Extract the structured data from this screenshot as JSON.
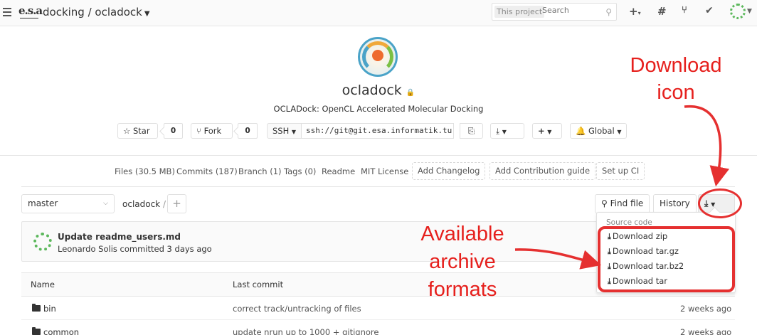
{
  "nav": {
    "logo_text": "e.s.a",
    "breadcrumb": "docking / ocladock",
    "search_scope": "This project",
    "search_placeholder": "Search",
    "icons": [
      "plus-icon",
      "hash-icon",
      "merge-request-icon",
      "check-circle-icon"
    ]
  },
  "project": {
    "name": "ocladock",
    "description": "OCLADock: OpenCL Accelerated Molecular Docking",
    "star_label": "Star",
    "star_count": "0",
    "fork_label": "Fork",
    "fork_count": "0",
    "protocol": "SSH",
    "clone_url": "ssh://git@git.esa.informatik.tu",
    "notify_label": "Global"
  },
  "project_links": {
    "files": "Files (30.5 MB)",
    "commits": "Commits (187)",
    "branch": "Branch (1)",
    "tags": "Tags (0)",
    "readme": "Readme",
    "license": "MIT License",
    "add_changelog": "Add Changelog",
    "add_contribution": "Add Contribution guide",
    "setup_ci": "Set up CI"
  },
  "repo": {
    "branch": "master",
    "path": "ocladock",
    "path_sep": "/",
    "find_file": "Find file",
    "history": "History"
  },
  "last_commit": {
    "title": "Update readme_users.md",
    "meta": "Leonardo Solis committed 3 days ago"
  },
  "table": {
    "headers": {
      "name": "Name",
      "last_commit": "Last commit"
    },
    "rows": [
      {
        "name": "bin",
        "commit": "correct track/untracking of files",
        "time": "2 weeks ago"
      },
      {
        "name": "common",
        "commit": "update nrun up to 1000 + gitignore",
        "time": "2 weeks ago"
      }
    ]
  },
  "download_menu": {
    "header": "Source code",
    "items": [
      "Download zip",
      "Download tar.gz",
      "Download tar.bz2",
      "Download tar"
    ]
  },
  "annotations": {
    "download_icon_line1": "Download",
    "download_icon_line2": "icon",
    "formats_line1": "Available",
    "formats_line2": "archive",
    "formats_line3": "formats",
    "color": "#e6201d"
  }
}
